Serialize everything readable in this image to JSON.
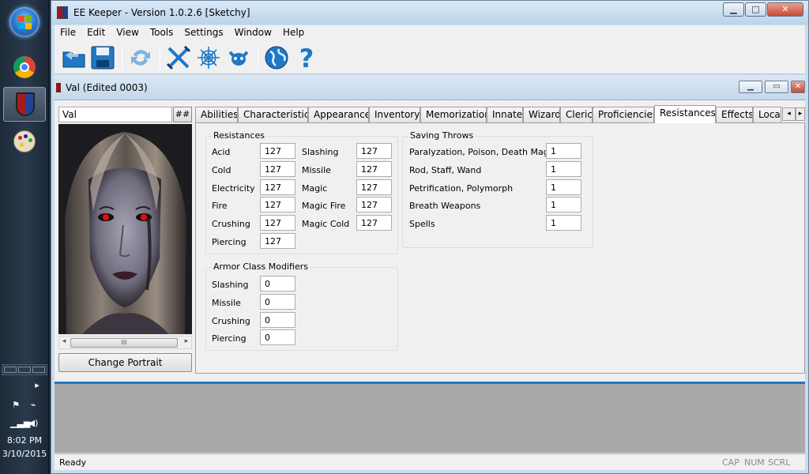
{
  "app": {
    "title": "EE Keeper - Version 1.0.2.6 [Sketchy]"
  },
  "menu": [
    "File",
    "Edit",
    "View",
    "Tools",
    "Settings",
    "Window",
    "Help"
  ],
  "child": {
    "title": "Val (Edited 0003)"
  },
  "character": {
    "name": "Val",
    "hash_label": "##",
    "change_portrait_label": "Change Portrait",
    "scroll_thumb": "III"
  },
  "tabs": [
    "Abilities",
    "Characteristics",
    "Appearance",
    "Inventory",
    "Memorization",
    "Innate",
    "Wizard",
    "Cleric",
    "Proficiencies",
    "Resistances",
    "Effects",
    "Local"
  ],
  "active_tab": "Resistances",
  "resistances": {
    "title": "Resistances",
    "left": [
      {
        "label": "Acid",
        "value": "127"
      },
      {
        "label": "Cold",
        "value": "127"
      },
      {
        "label": "Electricity",
        "value": "127"
      },
      {
        "label": "Fire",
        "value": "127"
      },
      {
        "label": "Crushing",
        "value": "127"
      },
      {
        "label": "Piercing",
        "value": "127"
      }
    ],
    "right": [
      {
        "label": "Slashing",
        "value": "127"
      },
      {
        "label": "Missile",
        "value": "127"
      },
      {
        "label": "Magic",
        "value": "127"
      },
      {
        "label": "Magic Fire",
        "value": "127"
      },
      {
        "label": "Magic Cold",
        "value": "127"
      }
    ]
  },
  "saving_throws": {
    "title": "Saving Throws",
    "items": [
      {
        "label": "Paralyzation, Poison, Death Magic",
        "value": "1"
      },
      {
        "label": "Rod, Staff, Wand",
        "value": "1"
      },
      {
        "label": "Petrification, Polymorph",
        "value": "1"
      },
      {
        "label": "Breath Weapons",
        "value": "1"
      },
      {
        "label": "Spells",
        "value": "1"
      }
    ]
  },
  "armor_class": {
    "title": "Armor Class Modifiers",
    "items": [
      {
        "label": "Slashing",
        "value": "0"
      },
      {
        "label": "Missile",
        "value": "0"
      },
      {
        "label": "Crushing",
        "value": "0"
      },
      {
        "label": "Piercing",
        "value": "0"
      }
    ]
  },
  "status": {
    "ready": "Ready",
    "cap": "CAP",
    "num": "NUM",
    "scrl": "SCRL"
  },
  "clock": {
    "time": "8:02 PM",
    "date": "3/10/2015"
  },
  "colors": {
    "accent": "#1f78c8",
    "titlebar": "#c8dcef",
    "portrait_eyes": "#e01010"
  }
}
